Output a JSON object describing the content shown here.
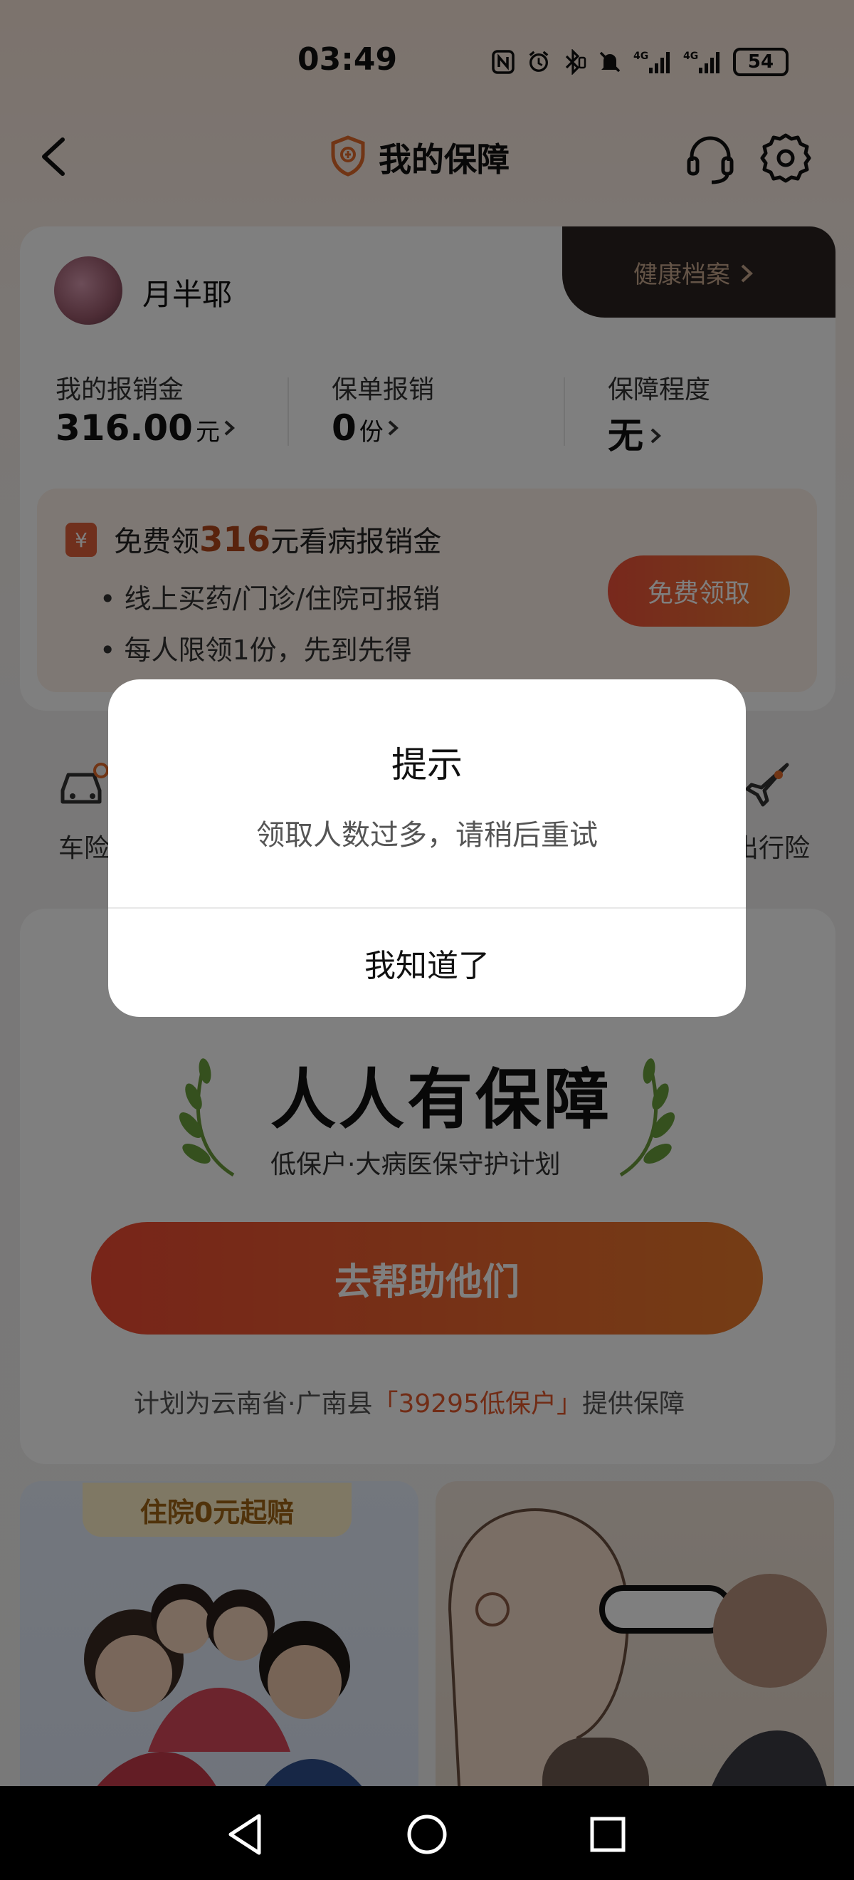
{
  "status_bar": {
    "time": "03:49",
    "battery": "54",
    "icons": [
      "nfc-icon",
      "alarm-icon",
      "bluetooth-icon",
      "vibrate-icon",
      "mute-bell-icon",
      "signal-4g-icon",
      "signal-4g-icon"
    ]
  },
  "header": {
    "title": "我的保障",
    "back_icon": "chevron-left-icon",
    "service_icon": "headset-icon",
    "settings_icon": "gear-icon"
  },
  "profile": {
    "username": "月半耶",
    "health_record_label": "健康档案"
  },
  "stats": [
    {
      "label": "我的报销金",
      "value": "316.00",
      "unit": "元"
    },
    {
      "label": "保单报销",
      "value": "0",
      "unit": "份"
    },
    {
      "label": "保障程度",
      "value": "无",
      "unit": ""
    }
  ],
  "promo": {
    "title_prefix": "免费领",
    "title_amount": "316",
    "title_suffix": "元看病报销金",
    "bullets": [
      "线上买药/门诊/住院可报销",
      "每人限领1份，先到先得"
    ],
    "button_label": "免费领取"
  },
  "categories": {
    "left_label": "车险",
    "right_label": "出行险"
  },
  "banner": {
    "title": "人人有保障",
    "subtitle": "低保户·大病医保守护计划",
    "button_label": "去帮助他们",
    "plan_prefix": "计划为云南省·广南县",
    "plan_highlight": "「39295低保户」",
    "plan_suffix": "提供保障"
  },
  "cards": {
    "left_badge": "住院0元起赔"
  },
  "dialog": {
    "title": "提示",
    "message": "领取人数过多，请稍后重试",
    "confirm_label": "我知道了"
  },
  "colors": {
    "accent": "#f0513a",
    "accent_end": "#ea7a2a",
    "dark_tab": "#2b2320",
    "highlight_text": "#e2592d"
  }
}
